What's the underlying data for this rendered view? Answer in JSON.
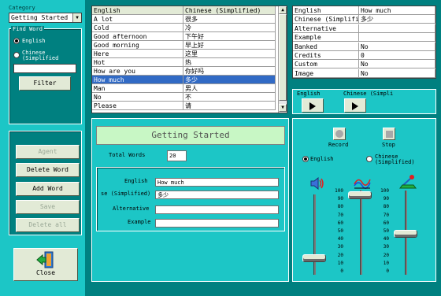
{
  "left": {
    "category_label": "Category",
    "category_value": "Getting Started",
    "find_word": {
      "group_label": "Find Word",
      "english": "English",
      "chinese_line1": "Chinese",
      "chinese_line2": "(Simplified",
      "filter_label": "Filter"
    },
    "buttons": {
      "agent": "Agent",
      "delete_word": "Delete Word",
      "add_word": "Add Word",
      "save": "Save",
      "delete_all": "Delete all",
      "close": "Close"
    }
  },
  "word_list": {
    "headers": [
      "English",
      "Chinese (Simplified)"
    ],
    "rows": [
      [
        "A lot",
        "很多"
      ],
      [
        "Cold",
        "冷"
      ],
      [
        "Good afternoon",
        "下午好"
      ],
      [
        "Good morning",
        "早上好"
      ],
      [
        "Here",
        "这里"
      ],
      [
        "Hot",
        "热"
      ],
      [
        "How are you",
        "你好吗"
      ],
      [
        "How much",
        "多少"
      ],
      [
        "Man",
        "男人"
      ],
      [
        "No",
        "不"
      ],
      [
        "Please",
        "请"
      ]
    ],
    "selected_index": 7
  },
  "props": {
    "rows": [
      [
        "English",
        "How much"
      ],
      [
        "Chinese (Simplifie",
        "多少"
      ],
      [
        "Alternative",
        ""
      ],
      [
        "Example",
        ""
      ],
      [
        "Banked",
        "No"
      ],
      [
        "Credits",
        "0"
      ],
      [
        "Custom",
        "No"
      ],
      [
        "Image",
        "No"
      ]
    ]
  },
  "playback": {
    "english": "English",
    "chinese": "Chinese (Simpli"
  },
  "editor": {
    "title": "Getting Started",
    "total_words_label": "Total Words",
    "total_words": "20",
    "english_label": "English",
    "english_value": "How much",
    "chinese_label": "se (Simplified)",
    "chinese_value": "多少",
    "alternative_label": "Alternative",
    "alternative_value": "",
    "example_label": "Example",
    "example_value": ""
  },
  "recorder": {
    "record_label": "Record",
    "stop_label": "Stop",
    "english": "English",
    "chinese_line1": "Chinese",
    "chinese_line2": "(Simplified)",
    "scale": [
      "100",
      "90",
      "80",
      "70",
      "60",
      "50",
      "40",
      "30",
      "20",
      "10",
      "0"
    ],
    "volume_level": 0.2,
    "pitch_level": 1.0,
    "speed_level": 0.5
  }
}
